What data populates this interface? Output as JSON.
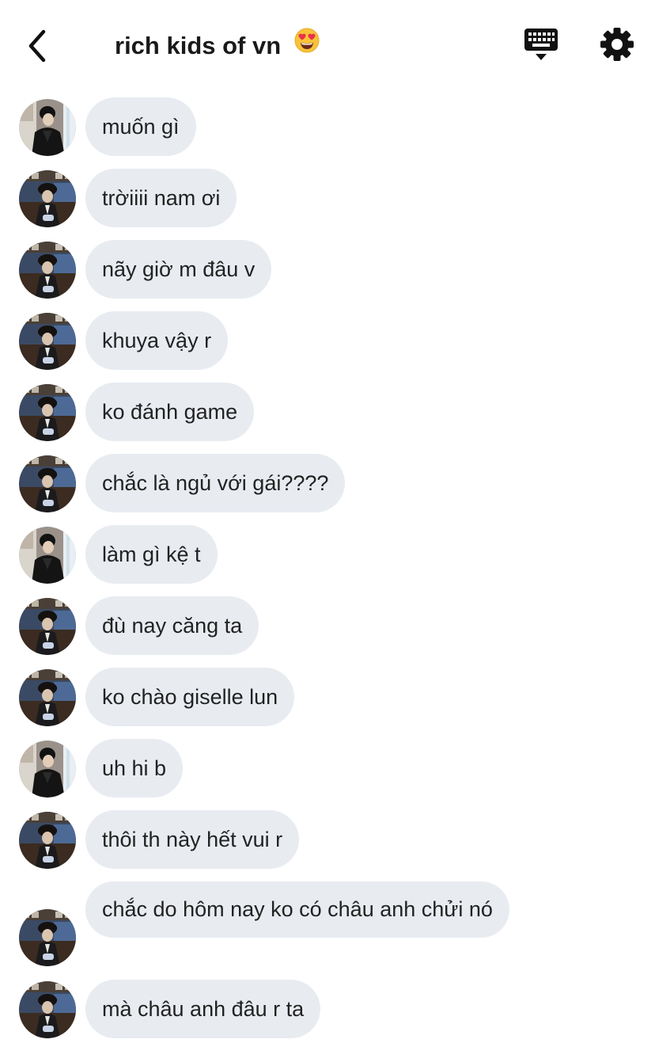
{
  "header": {
    "title": "rich kids of vn",
    "title_emoji": "heart-eyes-emoji",
    "back_icon": "chevron-left-icon",
    "keyboard_icon": "keyboard-icon",
    "settings_icon": "gear-icon"
  },
  "colors": {
    "bubble_bg": "#e8ecf1",
    "text": "#222222",
    "icon": "#111111"
  },
  "messages": [
    {
      "text": "muốn gì",
      "avatar": "avatar-b"
    },
    {
      "text": "trờiiii nam ơi",
      "avatar": "avatar-a"
    },
    {
      "text": "nãy giờ m đâu v",
      "avatar": "avatar-a"
    },
    {
      "text": "khuya vậy r",
      "avatar": "avatar-a"
    },
    {
      "text": "ko đánh game",
      "avatar": "avatar-a"
    },
    {
      "text": "chắc là ngủ với gái????",
      "avatar": "avatar-a"
    },
    {
      "text": "làm gì kệ t",
      "avatar": "avatar-b"
    },
    {
      "text": "đù nay căng ta",
      "avatar": "avatar-a"
    },
    {
      "text": "ko chào giselle lun",
      "avatar": "avatar-a"
    },
    {
      "text": "uh hi b",
      "avatar": "avatar-b"
    },
    {
      "text": "thôi th này hết vui r",
      "avatar": "avatar-a"
    },
    {
      "text": "chắc do hôm nay ko có châu anh chửi nó",
      "avatar": "avatar-a"
    },
    {
      "text": "mà châu anh đâu r ta",
      "avatar": "avatar-a"
    }
  ]
}
